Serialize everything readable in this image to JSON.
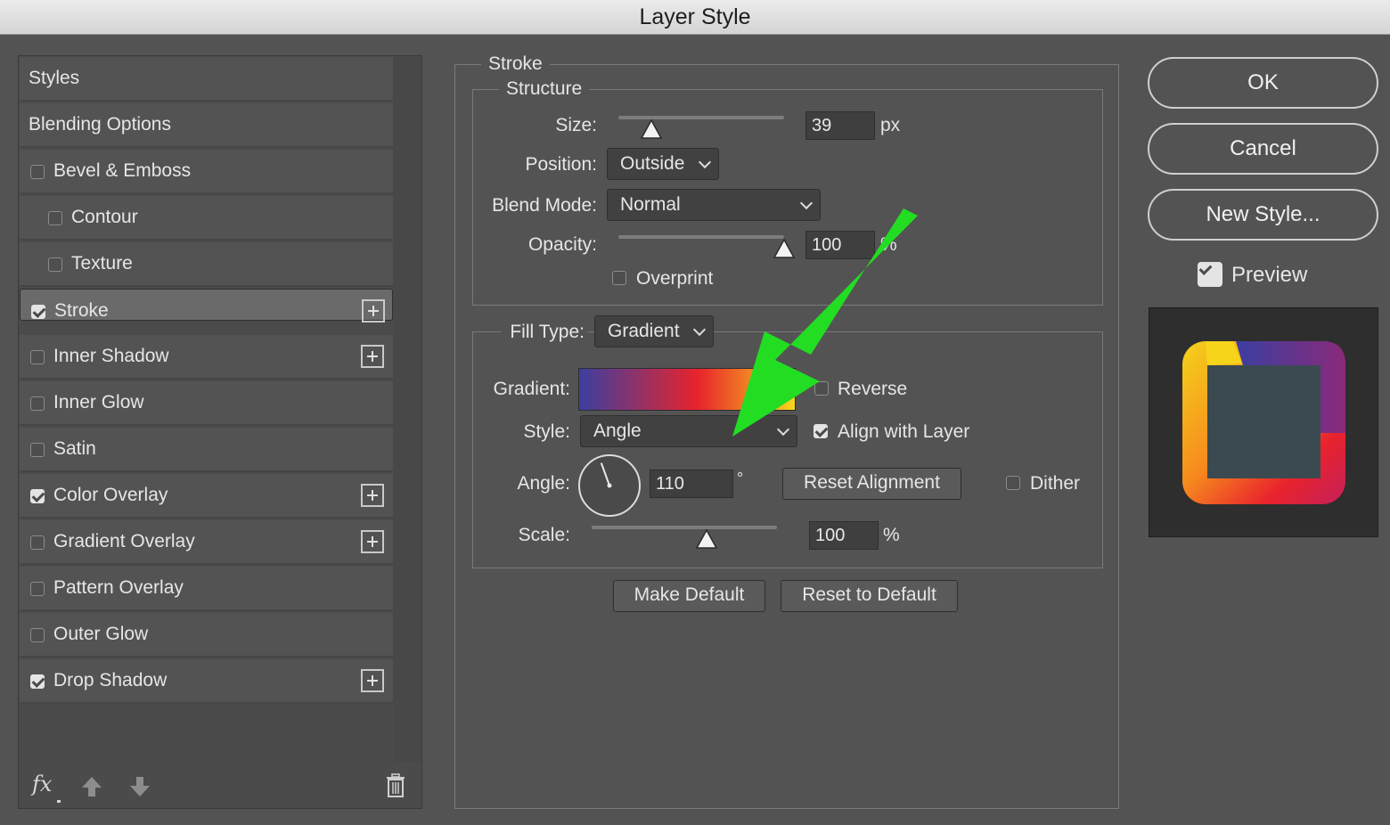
{
  "window": {
    "title": "Layer Style"
  },
  "left_panel": {
    "items": [
      {
        "label": "Styles",
        "checkbox": null,
        "plus": false,
        "selected": false
      },
      {
        "label": "Blending Options",
        "checkbox": null,
        "plus": false,
        "selected": false
      },
      {
        "label": "Bevel & Emboss",
        "checkbox": false,
        "plus": false,
        "selected": false
      },
      {
        "label": "Contour",
        "checkbox": false,
        "plus": false,
        "selected": false
      },
      {
        "label": "Texture",
        "checkbox": false,
        "plus": false,
        "selected": false
      },
      {
        "label": "Stroke",
        "checkbox": true,
        "plus": true,
        "selected": true
      },
      {
        "label": "Inner Shadow",
        "checkbox": false,
        "plus": true,
        "selected": false
      },
      {
        "label": "Inner Glow",
        "checkbox": false,
        "plus": false,
        "selected": false
      },
      {
        "label": "Satin",
        "checkbox": false,
        "plus": false,
        "selected": false
      },
      {
        "label": "Color Overlay",
        "checkbox": true,
        "plus": true,
        "selected": false
      },
      {
        "label": "Gradient Overlay",
        "checkbox": false,
        "plus": true,
        "selected": false
      },
      {
        "label": "Pattern Overlay",
        "checkbox": false,
        "plus": false,
        "selected": false
      },
      {
        "label": "Outer Glow",
        "checkbox": false,
        "plus": false,
        "selected": false
      },
      {
        "label": "Drop Shadow",
        "checkbox": true,
        "plus": true,
        "selected": false
      }
    ],
    "footer": {
      "fx_label": "fx",
      "icons": [
        "fx-icon",
        "move-up-icon",
        "move-down-icon",
        "trash-icon"
      ]
    }
  },
  "stroke": {
    "section_title": "Stroke",
    "structure": {
      "title": "Structure",
      "size_label": "Size:",
      "size_value": "39",
      "size_unit": "px",
      "size_slider_fraction": 0.2,
      "position_label": "Position:",
      "position_value": "Outside",
      "blend_mode_label": "Blend Mode:",
      "blend_mode_value": "Normal",
      "opacity_label": "Opacity:",
      "opacity_value": "100",
      "opacity_unit": "%",
      "opacity_slider_fraction": 1.0,
      "overprint_label": "Overprint",
      "overprint_checked": false
    },
    "fill": {
      "fill_type_label": "Fill Type:",
      "fill_type_value": "Gradient",
      "gradient_label": "Gradient:",
      "gradient_colors": [
        "#3b3fa0",
        "#e8232c",
        "#f9d71c"
      ],
      "reverse_label": "Reverse",
      "reverse_checked": false,
      "style_label": "Style:",
      "style_value": "Angle",
      "align_label": "Align with Layer",
      "align_checked": true,
      "angle_label": "Angle:",
      "angle_value": "110",
      "angle_unit": "°",
      "reset_alignment_label": "Reset Alignment",
      "dither_label": "Dither",
      "dither_checked": false,
      "scale_label": "Scale:",
      "scale_value": "100",
      "scale_unit": "%",
      "scale_slider_fraction": 0.62
    },
    "make_default_label": "Make Default",
    "reset_default_label": "Reset to Default"
  },
  "right_panel": {
    "ok_label": "OK",
    "cancel_label": "Cancel",
    "new_style_label": "New Style...",
    "preview_label": "Preview",
    "preview_checked": true
  },
  "annotation": {
    "arrow_color": "#22dd22"
  }
}
